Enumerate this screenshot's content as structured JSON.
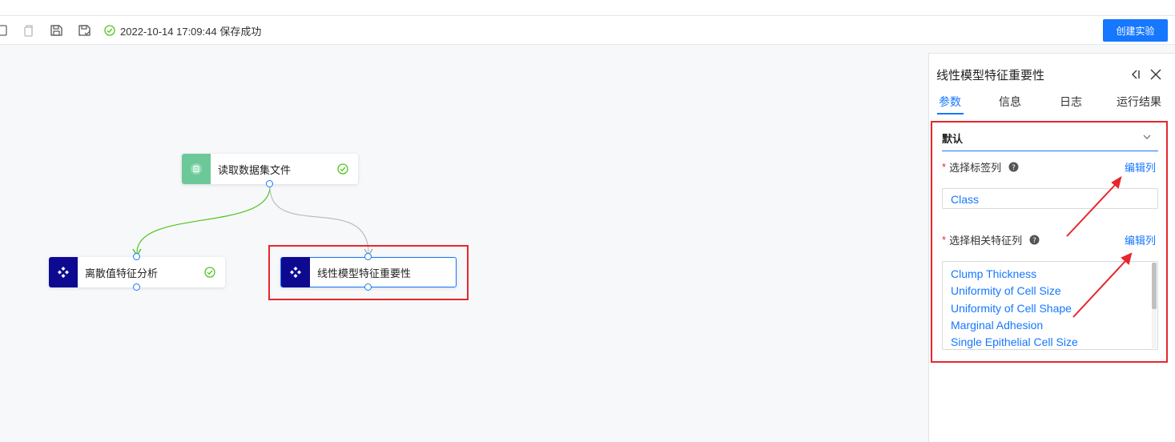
{
  "toolbar": {
    "icons": [
      "copy-icon",
      "paste-icon",
      "save-icon",
      "save-as-icon"
    ],
    "save_status": "2022-10-14 17:09:44 保存成功",
    "create_button": "创建实验"
  },
  "canvas": {
    "nodes": [
      {
        "id": "read",
        "label": "读取数据集文件",
        "icon": "dataset-icon",
        "status": "success",
        "accent": "#6cc898"
      },
      {
        "id": "discrete",
        "label": "离散值特征分析",
        "icon": "component-icon",
        "status": "success",
        "accent": "#0d0a91"
      },
      {
        "id": "linear",
        "label": "线性模型特征重要性",
        "icon": "component-icon",
        "status": "selected",
        "accent": "#0d0a91"
      }
    ]
  },
  "panel": {
    "title": "线性模型特征重要性",
    "tabs": [
      "参数",
      "信息",
      "日志",
      "运行结果"
    ],
    "active_tab": "参数",
    "group_title": "默认",
    "label_field": {
      "label": "选择标签列",
      "edit_link": "编辑列",
      "value": "Class"
    },
    "feature_field": {
      "label": "选择相关特征列",
      "edit_link": "编辑列",
      "values": [
        "Clump Thickness",
        "Uniformity of Cell Size",
        "Uniformity of Cell Shape",
        "Marginal Adhesion",
        "Single Epithelial Cell Size"
      ]
    }
  },
  "colors": {
    "accent": "#1677ff",
    "success": "#52c41a",
    "highlight": "#e8262c"
  }
}
